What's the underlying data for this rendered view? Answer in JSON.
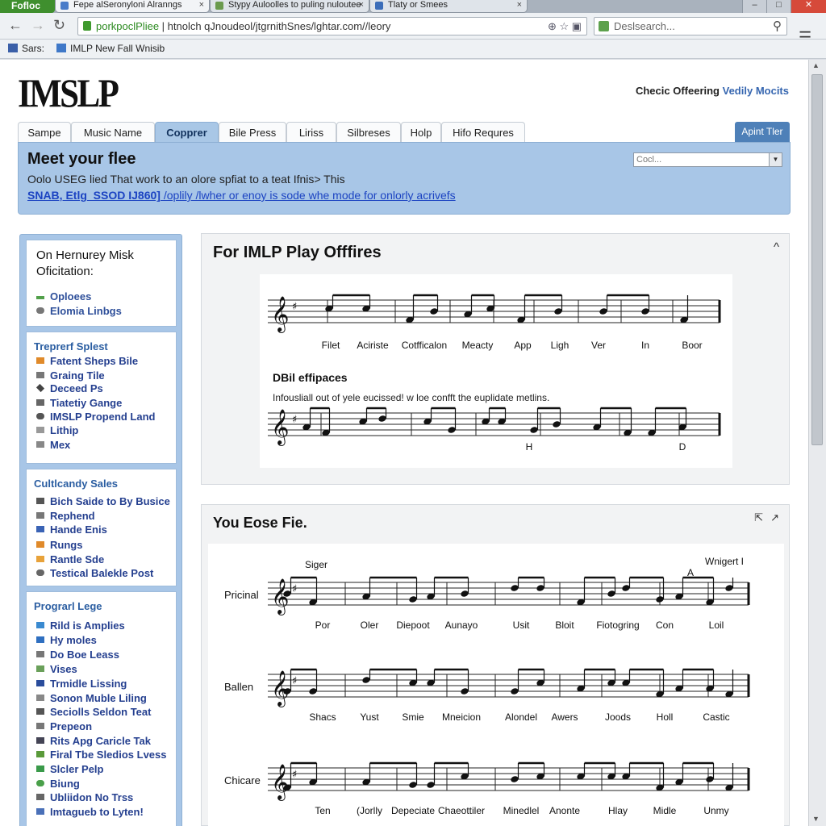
{
  "browser": {
    "app_button": "Fofloc",
    "tabs": [
      "Fepe alSeronyloni Alranngs",
      "Stypy Auloolles to puling nuloutee",
      "Tlaty or Smees"
    ],
    "url_host": "porkpoclPliee",
    "url_rest": " | htnolch qJnoudeol/jtgrnithSnes/lghtar.com//leory",
    "search_placeholder": "Deslsearch...",
    "bookmarks": [
      "Sars:",
      "IMLP New Fall Wnisib"
    ],
    "window_buttons": [
      "–",
      "□",
      "✕"
    ]
  },
  "site": {
    "logo": "IMSLP",
    "top_right_text": "Checic Offeering",
    "top_right_link": "Vedily Mocits",
    "tabs": [
      "Sampe",
      "Music Name",
      "Copprer",
      "Bile Press",
      "Liriss",
      "Silbreses",
      "Holp",
      "Hifo Requres"
    ],
    "active_tab": 2,
    "add_button": "Apint Tler"
  },
  "banner": {
    "title": "Meet your flee",
    "text": "Oolo USEG lied That work to an olore spfiat to a teat Ifnis> This",
    "link_bold": "SNAB, Etlg_SSOD IJ860]",
    "link_rest": " /oplily /lwher or enoy is sode whe mode for onlorly acrivefs",
    "select_placeholder": "Cocl..."
  },
  "sidebar": {
    "box1": {
      "title": "On Hernurey Misk Oficitation:",
      "items": [
        "Oploees",
        "Elomia Linbgs"
      ]
    },
    "box2": {
      "heading": "Treprerf Splest",
      "items": [
        "Fatent Sheps Bile",
        "Graing Tile",
        "Deceed Ps",
        "Tiatetiy Gange",
        "IMSLP Propend Land",
        "Lithip",
        "Mex"
      ]
    },
    "box3": {
      "heading": "Cultlcandy Sales",
      "items": [
        "Bich Saide to By Busice",
        "Rephend",
        "Hande Enis",
        "Rungs",
        "Rantle Sde",
        "Testical Balekle Post"
      ]
    },
    "box4": {
      "heading": "Prograrl Lege",
      "items": [
        "Rild is Amplies",
        "Hy moles",
        "Do Boe Leass",
        "Vises",
        "Trmidle Lissing",
        "Sonon Muble Liling",
        "Seciolls Seldon Teat",
        "Prepeon",
        "Rits Apg Caricle Tak",
        "Firal Tbe Sledios Lvess",
        "Slcler Pelp",
        "Biung",
        "Ubliidon No Trss",
        "Imtagueb to Lyten!"
      ]
    }
  },
  "panel1": {
    "title": "For IMLP Play Offfires",
    "collapse": "^",
    "staff1_labels": [
      "Filet",
      "Aciriste",
      "Cotfficalon",
      "Meacty",
      "App",
      "Ligh",
      "Ver",
      "In",
      "Boor"
    ],
    "subheading": "DBil effipaces",
    "subtext": "Infousliall out of yele eucissed! w loe confft the euplidate metlins.",
    "staff2_labels": [
      "H",
      "D"
    ]
  },
  "panel2": {
    "title": "You Eose Fie.",
    "controls": [
      "⇱",
      "↗"
    ],
    "corner_label": "Wnigert I",
    "marker_A": "A",
    "row1_top_label": "Siger",
    "rows": [
      {
        "name": "Pricinal",
        "labels": [
          "Por",
          "Oler",
          "Diepoot",
          "Aunayo",
          "Usit",
          "Bloit",
          "Fiotogring",
          "Con",
          "Loil"
        ]
      },
      {
        "name": "Ballen",
        "labels": [
          "Shacs",
          "Yust",
          "Smie",
          "Mneicion",
          "Alondel",
          "Awers",
          "Joods",
          "Holl",
          "Castic"
        ]
      },
      {
        "name": "Chicare",
        "labels": [
          "Ten",
          "(Jorlly",
          "Depeciate",
          "Chaeottiler",
          "Minedlel",
          "Anonte",
          "Hlay",
          "Midle",
          "Unmy"
        ]
      }
    ]
  },
  "colors": {
    "accent_blue": "#a8c6e7",
    "link_blue": "#1b43c2",
    "button_blue": "#4e80b8",
    "app_green": "#3f8f2e"
  }
}
